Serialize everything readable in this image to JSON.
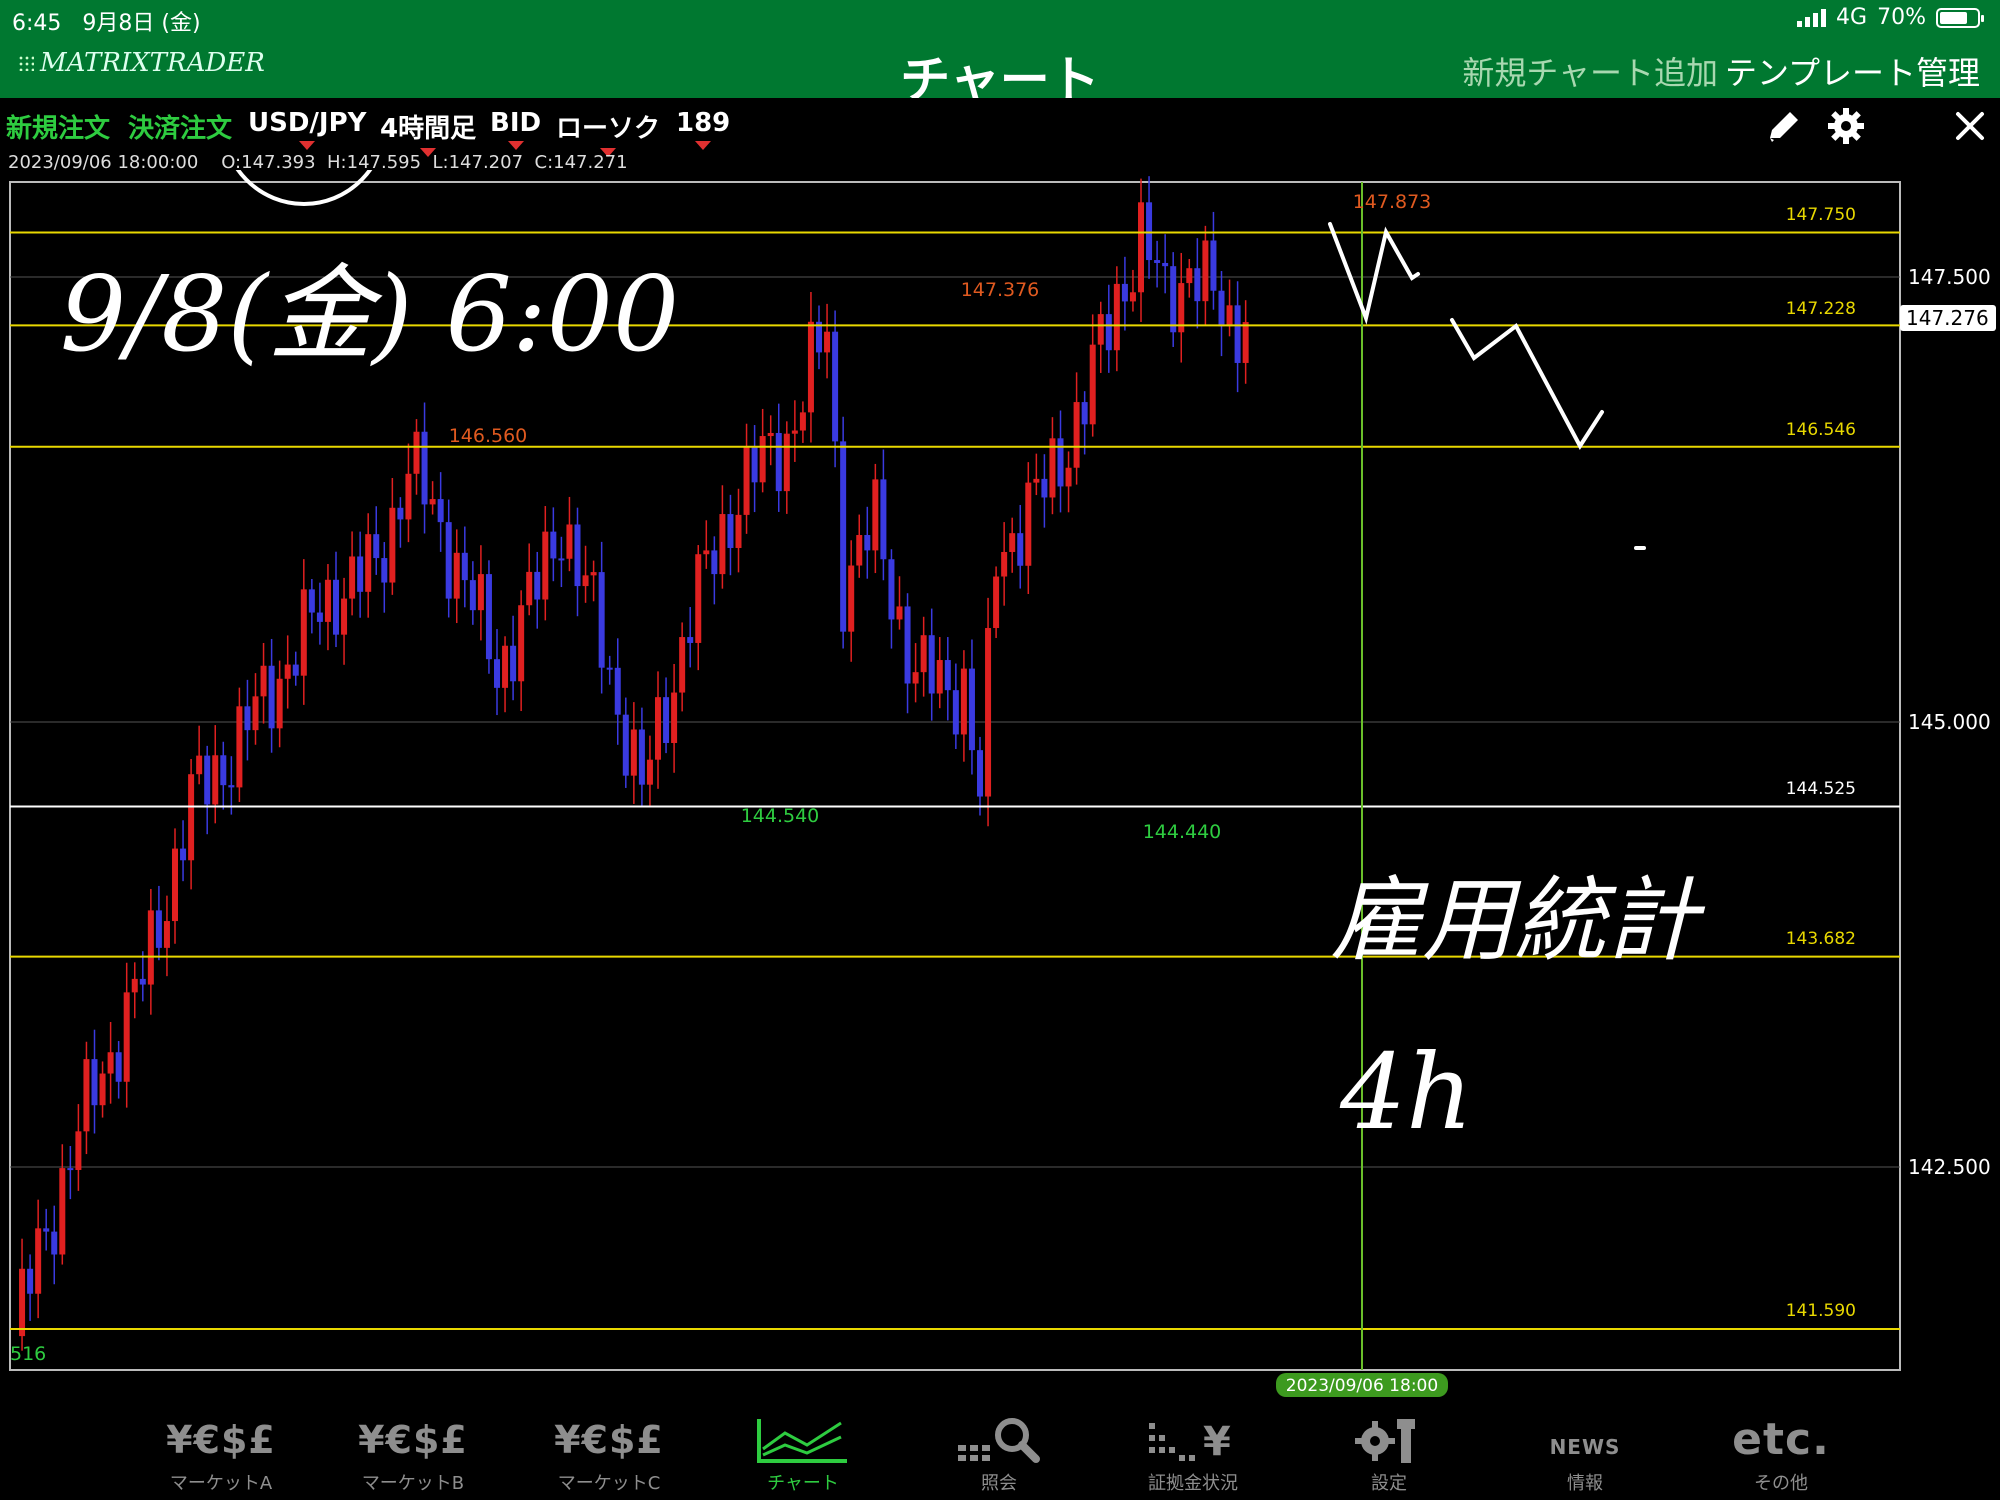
{
  "status": {
    "time": "6:45",
    "date": "9月8日 (金)",
    "network": "4G",
    "battery": "70%"
  },
  "nav": {
    "logo": "MATRIXTRADER",
    "title": "チャート",
    "add_chart": "新規チャート追加",
    "template": "テンプレート管理"
  },
  "toolbar": {
    "new_order": "新規注文",
    "settle_order": "決済注文",
    "pair": "USD/JPY",
    "timeframe": "4時間足",
    "price_type": "BID",
    "chart_type": "ローソク",
    "count": "189"
  },
  "ohlc": {
    "datetime": "2023/09/06 18:00:00",
    "open": "O:147.393",
    "high": "H:147.595",
    "low": "L:147.207",
    "close": "C:147.271"
  },
  "chart": {
    "y_ticks": [
      "147.500",
      "145.000",
      "142.500"
    ],
    "current_price": "147.276",
    "h_lines": [
      {
        "price": 147.75,
        "label": "147.750",
        "color": "#e8d800"
      },
      {
        "price": 147.228,
        "label": "147.228",
        "color": "#e8d800"
      },
      {
        "price": 146.546,
        "label": "146.546",
        "color": "#e8d800"
      },
      {
        "price": 144.525,
        "label": "144.525",
        "color": "#ffffff"
      },
      {
        "price": 143.682,
        "label": "143.682",
        "color": "#e8d800"
      },
      {
        "price": 141.59,
        "label": "141.590",
        "color": "#e8d800"
      }
    ],
    "peaks": [
      {
        "label": "146.560",
        "color": "#e05a20"
      },
      {
        "label": "147.376",
        "color": "#e05a20"
      },
      {
        "label": "147.873",
        "color": "#e05a20"
      },
      {
        "label": "144.540",
        "color": "#2ecc40"
      },
      {
        "label": "144.440",
        "color": "#2ecc40"
      }
    ],
    "left_value": "516",
    "crosshair_time": "2023/09/06 18:00"
  },
  "chart_data": {
    "type": "candlestick",
    "symbol": "USD/JPY",
    "y_ticks": [
      147.5,
      145.0,
      142.5
    ],
    "highlighted_levels": [
      147.75,
      147.228,
      146.546,
      144.525,
      143.682,
      141.59
    ],
    "current_price": 147.276,
    "marked_extremes": {
      "highs": [
        146.56,
        147.376,
        147.873
      ],
      "lows": [
        144.54,
        144.44
      ]
    }
  },
  "handwriting": {
    "line1": "9/8(金) 6:00",
    "line2": "雇用統計",
    "line3": "4h"
  },
  "colors": {
    "header": "#007830",
    "up": "#e02020",
    "down": "#3a3ae0",
    "level": "#e8d800",
    "accent": "#2ecc40"
  },
  "tabs": [
    {
      "label": "マーケットA",
      "icon": "¥€$£"
    },
    {
      "label": "マーケットB",
      "icon": "¥€$£"
    },
    {
      "label": "マーケットC",
      "icon": "¥€$£"
    },
    {
      "label": "チャート",
      "icon": "chart-icon"
    },
    {
      "label": "照会",
      "icon": "search-icon"
    },
    {
      "label": "証拠金状況",
      "icon": "margin-icon"
    },
    {
      "label": "設定",
      "icon": "settings-icon"
    },
    {
      "label": "情報",
      "icon": "NEWS"
    },
    {
      "label": "その他",
      "icon": "etc."
    }
  ]
}
